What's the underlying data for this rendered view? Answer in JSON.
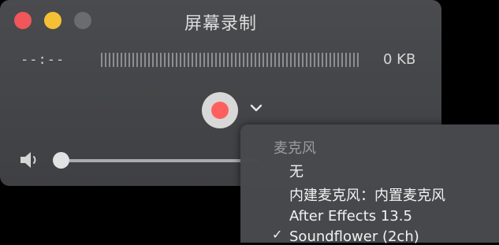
{
  "window": {
    "title": "屏幕录制"
  },
  "recording": {
    "elapsed": "--:--",
    "file_size": "0 KB"
  },
  "volume": {
    "level": 0.0
  },
  "menu": {
    "header": "麦克风",
    "items": [
      {
        "label": "无"
      },
      {
        "label": "内建麦克风：内置麦克风"
      },
      {
        "label": "After Effects 13.5"
      },
      {
        "label": "Soundflower (2ch)",
        "checked": true
      }
    ]
  },
  "icons": {
    "close": "close-traffic-light-icon",
    "minimize": "minimize-traffic-light-icon",
    "zoom": "zoom-traffic-light-icon",
    "record": "record-icon",
    "chevron": "chevron-down-icon",
    "speaker": "speaker-icon",
    "check": "checkmark-icon"
  },
  "colors": {
    "record_red": "#ff5f5f",
    "close_red": "#f0565a",
    "minimize_yellow": "#f5c034"
  }
}
